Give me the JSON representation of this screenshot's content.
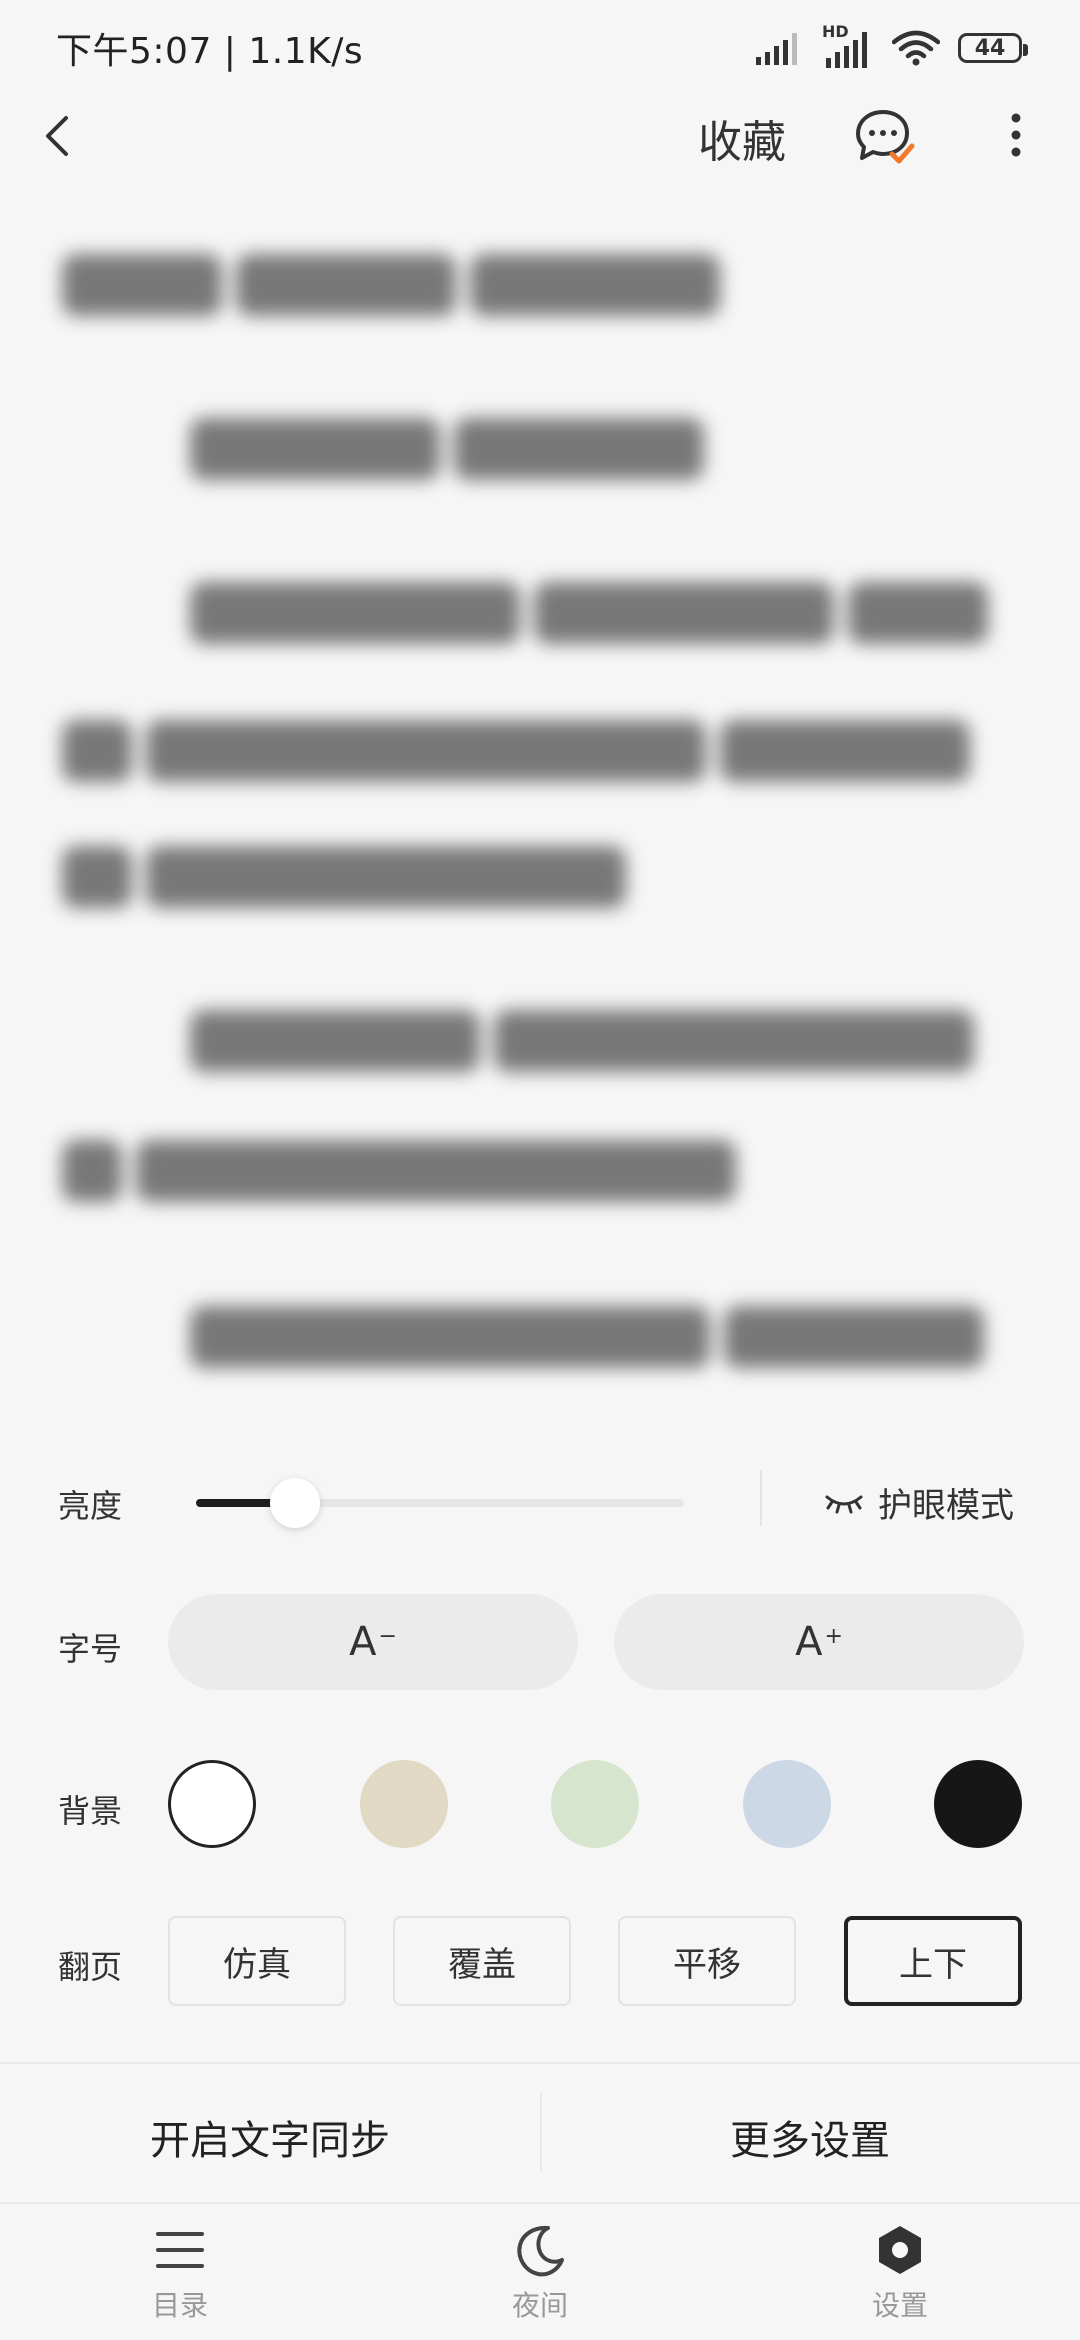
{
  "status_bar": {
    "time": "下午5:07 | 1.1K/s",
    "network_badge": "HD",
    "battery": "44"
  },
  "header": {
    "collect_label": "收藏",
    "icons": [
      "back-arrow-icon",
      "chat-check-icon",
      "more-vertical-icon"
    ]
  },
  "settings": {
    "brightness_label": "亮度",
    "brightness_level": 0.2,
    "eye_mode_label": "护眼模式",
    "font_size_label": "字号",
    "font_decrease": "A",
    "font_decrease_mark": "−",
    "font_increase": "A",
    "font_increase_mark": "+",
    "background_label": "背景",
    "background_colors": [
      "#ffffff",
      "#e2d9c5",
      "#d6e5cd",
      "#cdd8e6",
      "#161616"
    ],
    "background_selected": 0,
    "page_turn_label": "翻页",
    "page_turn_options": [
      "仿真",
      "覆盖",
      "平移",
      "上下"
    ],
    "page_turn_selected": 3
  },
  "actions": {
    "text_sync": "开启文字同步",
    "more_settings": "更多设置"
  },
  "bottom_nav": {
    "toc": "目录",
    "night": "夜间",
    "settings": "设置"
  }
}
